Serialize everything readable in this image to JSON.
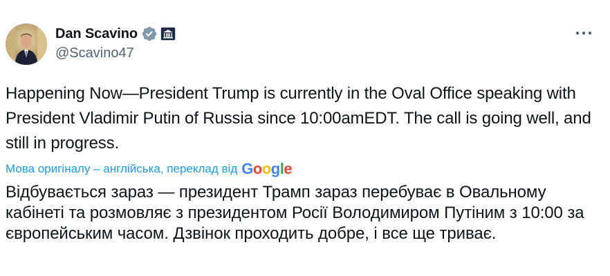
{
  "author": {
    "display_name": "Dan Scavino",
    "handle": "@Scavino47",
    "avatar_icon": "avatar-photo",
    "verified_icon": "verified-badge-icon",
    "affiliation_icon": "white-house-affiliation-icon"
  },
  "menu": {
    "icon": "more-icon"
  },
  "tweet": {
    "text": "Happening Now—President Trump is currently in the Oval Office speaking with President Vladimir Putin of Russia since 10:00amEDT. The call is going well, and still in progress."
  },
  "translation": {
    "label": "Мова оригіналу – англійська, переклад від",
    "provider": "Google",
    "text": "Відбувається зараз — президент Трамп зараз перебуває в Овальному кабінеті та розмовляє з президентом Росії Володимиром Путіним з 10:00 за європейським часом. Дзвінок проходить добре, і все ще триває."
  },
  "colors": {
    "link": "#1d9bf0",
    "secondary_text": "#536471",
    "primary_text": "#0f1419",
    "verified": "#829aab"
  }
}
